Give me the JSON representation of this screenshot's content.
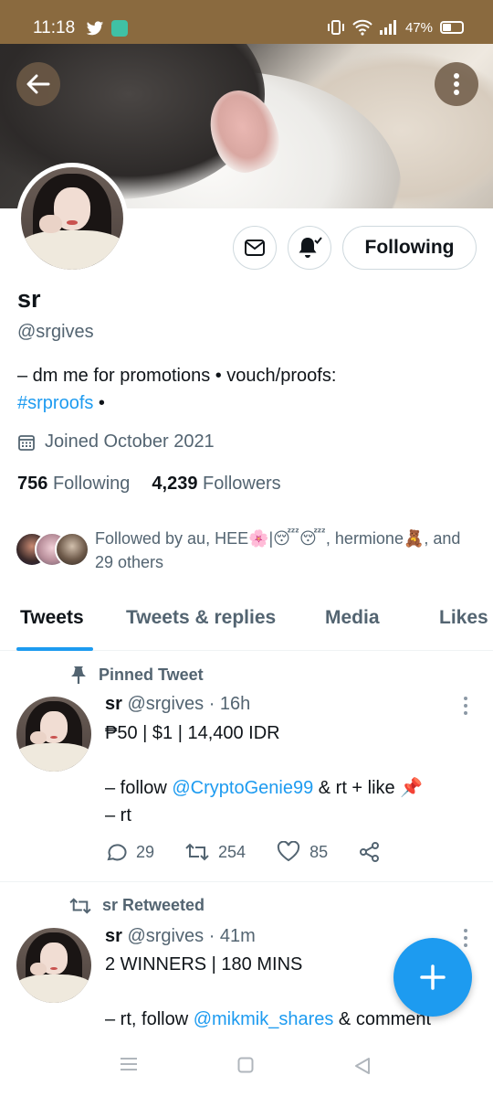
{
  "status_bar": {
    "time": "11:18",
    "battery": "47%"
  },
  "profile": {
    "name": "sr",
    "handle": "@srgives",
    "bio_text": "– dm me for promotions • vouch/proofs:",
    "bio_link": "#srproofs",
    "bio_suffix": " •",
    "joined": "Joined October 2021",
    "following_count": "756",
    "following_label": "Following",
    "followers_count": "4,239",
    "followers_label": "Followers",
    "followed_by": "Followed by au, HEE🌸|😴😴, hermione🧸, and 29 others",
    "follow_button": "Following"
  },
  "tabs": [
    {
      "label": "Tweets",
      "active": true
    },
    {
      "label": "Tweets & replies",
      "active": false
    },
    {
      "label": "Media",
      "active": false
    },
    {
      "label": "Likes",
      "active": false
    }
  ],
  "pinned_tweet": {
    "pinned_label": "Pinned Tweet",
    "name": "sr",
    "handle": "@srgives",
    "time": "· 16h",
    "line1": "₱50 | $1 | 14,400 IDR",
    "line2_prefix": "– follow ",
    "line2_mention": "@CryptoGenie99",
    "line2_suffix": " & rt + like 📌",
    "line3": "– rt",
    "replies": "29",
    "retweets": "254",
    "likes": "85"
  },
  "retweet": {
    "retweet_label": "sr Retweeted",
    "name": "sr",
    "handle": "@srgives",
    "time": "· 41m",
    "line1": "2 WINNERS | 180 MINS",
    "line2_prefix": "– rt, follow ",
    "line2_mention": "@mikmik_shares",
    "line2_suffix": " & comment"
  },
  "colors": {
    "accent": "#1d9bf0",
    "status_bar": "#8a6a3f",
    "secondary_text": "#536471"
  }
}
